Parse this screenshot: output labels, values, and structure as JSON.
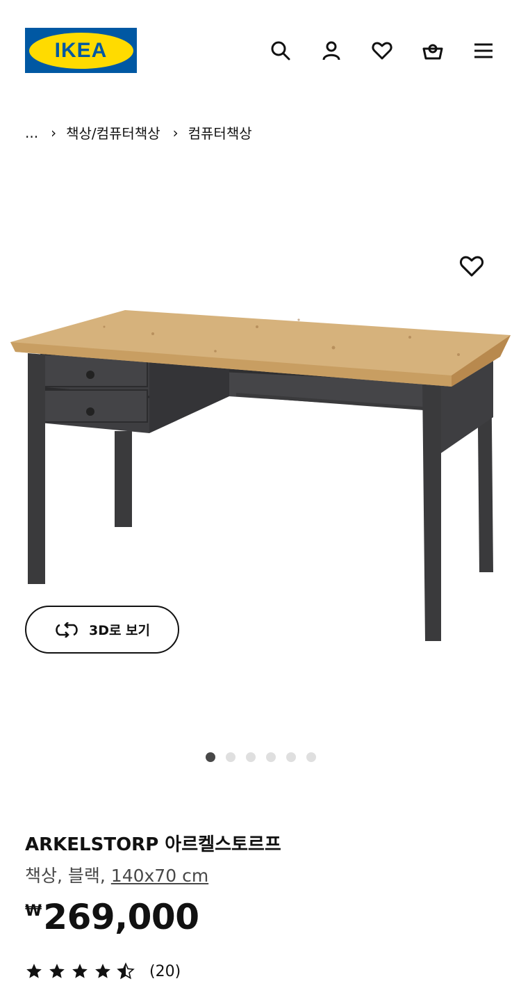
{
  "header": {
    "logo_text": "IKEA",
    "icons": [
      "search-icon",
      "account-icon",
      "heart-icon",
      "basket-icon",
      "menu-icon"
    ]
  },
  "breadcrumb": {
    "ellipsis": "...",
    "items": [
      "책상/컴퓨터책상",
      "컴퓨터책상"
    ]
  },
  "gallery": {
    "view3d_label": "3D로 보기",
    "dots_total": 6,
    "dots_active": 0
  },
  "product": {
    "name": "ARKELSTORP 아르켈스토르프",
    "type": "책상, 블랙, ",
    "size": "140x70 cm",
    "currency": "₩",
    "price": "269,000",
    "rating": 4.5,
    "review_count": "(20)"
  },
  "colors": {
    "ikea_blue": "#0058a3",
    "ikea_yellow": "#ffdb00"
  }
}
